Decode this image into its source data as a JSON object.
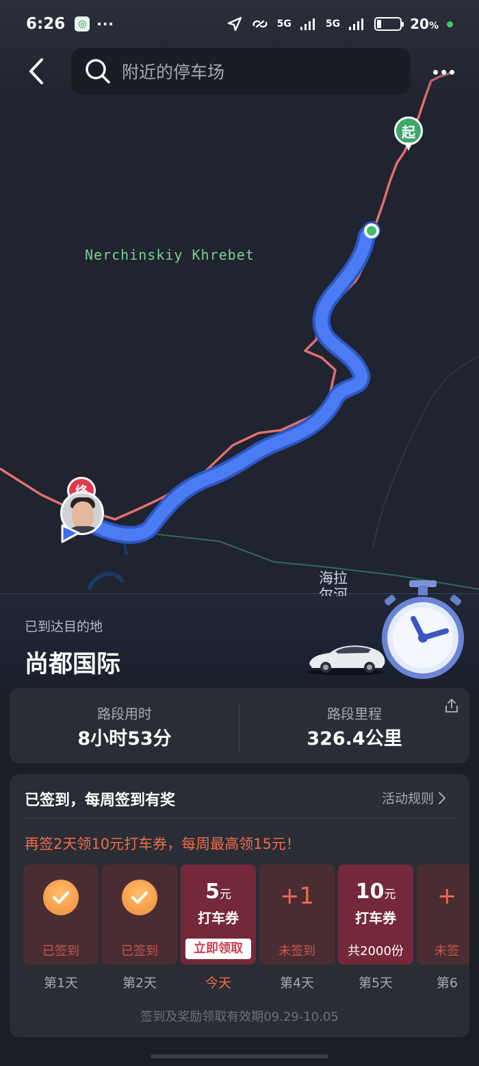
{
  "status_bar": {
    "time": "6:26",
    "app_icon": "fund-app-icon",
    "more": "···",
    "signal_1": "5G",
    "signal_2": "5G",
    "battery": "20",
    "battery_unit": "%",
    "battery_level": 0.2
  },
  "search": {
    "placeholder": "附近的停车场"
  },
  "map": {
    "region_label": "Nerchinskiy Khrebet",
    "river_label": "海拉尔河",
    "start_marker": "起",
    "end_marker": "终"
  },
  "arrival": {
    "subtitle": "已到达目的地",
    "destination": "尚都国际"
  },
  "stats": {
    "time_label": "路段用时",
    "time_value": "8小时53分",
    "distance_label": "路段里程",
    "distance_value": "326.4公里"
  },
  "checkin": {
    "title": "已签到，每周签到有奖",
    "rules": "活动规则",
    "promo": "再签2天领10元打车券，每周最高领15元！",
    "days": [
      {
        "label": "第1天",
        "status": "已签到",
        "kind": "checked"
      },
      {
        "label": "第2天",
        "status": "已签到",
        "kind": "checked"
      },
      {
        "label": "今天",
        "amount": "5",
        "unit": "元",
        "coupon": "打车券",
        "action": "立即领取",
        "kind": "reward-today"
      },
      {
        "label": "第4天",
        "plus": "+1",
        "status": "未签到",
        "kind": "pending"
      },
      {
        "label": "第5天",
        "amount": "10",
        "unit": "元",
        "coupon": "打车券",
        "total": "共2000份",
        "kind": "reward"
      },
      {
        "label": "第6",
        "plus": "+",
        "status": "未签",
        "kind": "pending"
      }
    ],
    "footer": "签到及奖励领取有效期09.29-10.05"
  },
  "colors": {
    "route_blue": "#4b7cf3",
    "track_red": "#e07070",
    "accent_orange": "#f06b4c",
    "start_green": "#3ea76a",
    "end_red": "#e2394e"
  }
}
